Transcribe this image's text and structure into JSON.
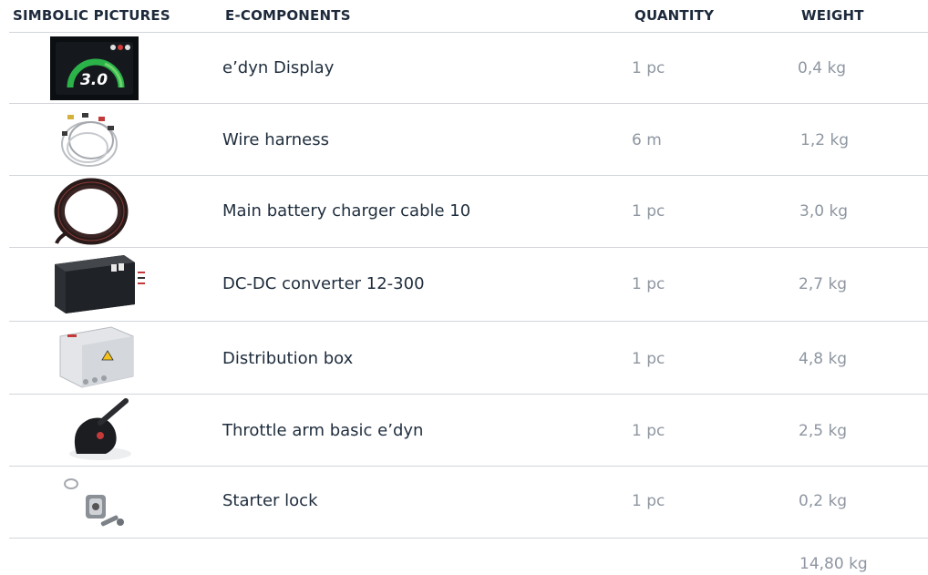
{
  "headers": {
    "pictures": "SIMBOLIC PICTURES",
    "components": "E-COMPONENTS",
    "quantity": "QUANTITY",
    "weight": "WEIGHT"
  },
  "rows": [
    {
      "name": "e’dyn Display",
      "qty": "1 pc",
      "weight": "0,4 kg",
      "image": "display-icon",
      "display_value": "3.0"
    },
    {
      "name": "Wire harness",
      "qty": "6 m",
      "weight": "1,2 kg",
      "image": "wire-harness-icon"
    },
    {
      "name": "Main battery charger cable 10",
      "qty": "1 pc",
      "weight": "3,0 kg",
      "image": "cable-coil-icon"
    },
    {
      "name": "DC-DC converter 12-300",
      "qty": "1 pc",
      "weight": "2,7 kg",
      "image": "converter-icon"
    },
    {
      "name": "Distribution box",
      "qty": "1 pc",
      "weight": "4,8 kg",
      "image": "distribution-box-icon"
    },
    {
      "name": "Throttle arm basic e’dyn",
      "qty": "1 pc",
      "weight": "2,5 kg",
      "image": "throttle-icon"
    },
    {
      "name": "Starter lock",
      "qty": "1 pc",
      "weight": "0,2 kg",
      "image": "key-lock-icon"
    }
  ],
  "total": {
    "weight": "14,80 kg"
  }
}
